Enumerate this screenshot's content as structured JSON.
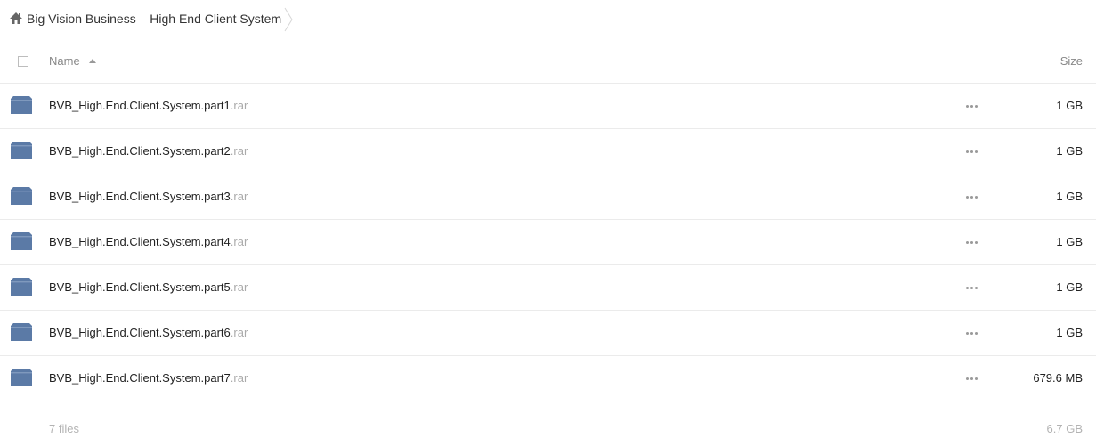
{
  "breadcrumb": {
    "title": "Big Vision Business – High End Client System",
    "home_icon": "home-icon",
    "separator_icon": "chevron-right-icon"
  },
  "table": {
    "header": {
      "name_label": "Name",
      "size_label": "Size",
      "sort": "ascending"
    },
    "rows": [
      {
        "name": "BVB_High.End.Client.System.part1",
        "ext": ".rar",
        "size": "1 GB"
      },
      {
        "name": "BVB_High.End.Client.System.part2",
        "ext": ".rar",
        "size": "1 GB"
      },
      {
        "name": "BVB_High.End.Client.System.part3",
        "ext": ".rar",
        "size": "1 GB"
      },
      {
        "name": "BVB_High.End.Client.System.part4",
        "ext": ".rar",
        "size": "1 GB"
      },
      {
        "name": "BVB_High.End.Client.System.part5",
        "ext": ".rar",
        "size": "1 GB"
      },
      {
        "name": "BVB_High.End.Client.System.part6",
        "ext": ".rar",
        "size": "1 GB"
      },
      {
        "name": "BVB_High.End.Client.System.part7",
        "ext": ".rar",
        "size": "679.6 MB"
      }
    ]
  },
  "footer": {
    "file_count": "7 files",
    "total_size": "6.7 GB"
  },
  "colors": {
    "file_icon": "#5b7aa6",
    "row_border": "#ebebeb",
    "muted_text": "#b3b3b3"
  }
}
